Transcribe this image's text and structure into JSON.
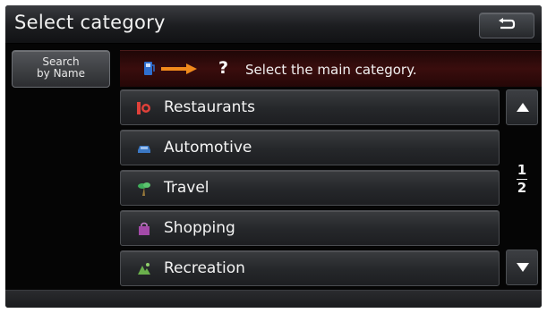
{
  "header": {
    "title": "Select category"
  },
  "toolbar": {
    "search_by_name_line1": "Search",
    "search_by_name_line2": "by Name",
    "back_icon": "return-arrow-icon"
  },
  "prompt": {
    "question_mark": "?",
    "text": "Select the main category."
  },
  "categories": [
    {
      "label": "Restaurants",
      "icon": "restaurant-icon",
      "color": "#e0413a"
    },
    {
      "label": "Automotive",
      "icon": "car-icon",
      "color": "#3b78c4"
    },
    {
      "label": "Travel",
      "icon": "palm-tree-icon",
      "color": "#3fae5a"
    },
    {
      "label": "Shopping",
      "icon": "shopping-bag-icon",
      "color": "#a34aa8"
    },
    {
      "label": "Recreation",
      "icon": "recreation-icon",
      "color": "#6ab04c"
    }
  ],
  "pagination": {
    "current": "1",
    "total": "2"
  },
  "colors": {
    "prompt_bar": "#3a0d0d",
    "arrow": "#f08a1c"
  }
}
